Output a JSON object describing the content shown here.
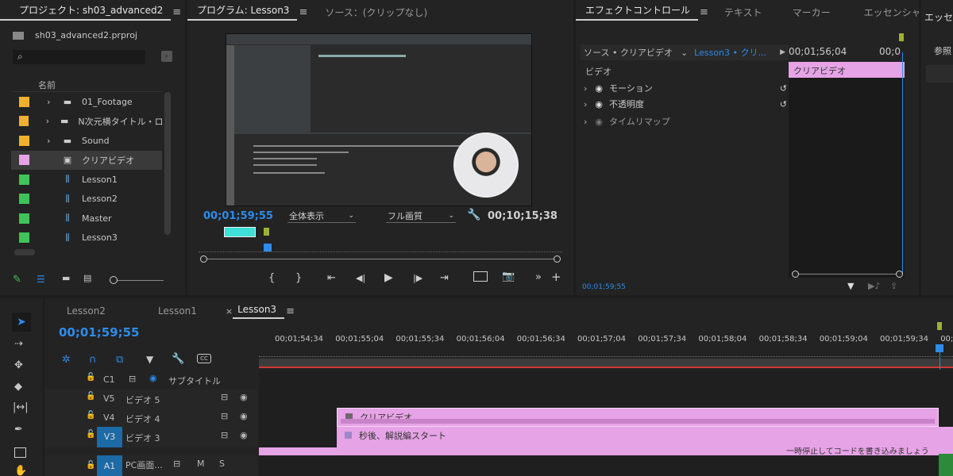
{
  "project": {
    "tab_title": "プロジェクト: sh03_advanced2",
    "file_name": "sh03_advanced2.prproj",
    "column_name": "名前",
    "items": [
      {
        "label": "01_Footage",
        "color": "#f2b02e",
        "type": "folder"
      },
      {
        "label": "N次元横タイトル・ロゴ",
        "color": "#f2b02e",
        "type": "folder"
      },
      {
        "label": "Sound",
        "color": "#f2b02e",
        "type": "folder"
      },
      {
        "label": "クリアビデオ",
        "color": "#e6a3e6",
        "type": "clip"
      },
      {
        "label": "Lesson1",
        "color": "#3ec45a",
        "type": "sequence"
      },
      {
        "label": "Lesson2",
        "color": "#3ec45a",
        "type": "sequence"
      },
      {
        "label": "Master",
        "color": "#3ec45a",
        "type": "sequence"
      },
      {
        "label": "Lesson3",
        "color": "#3ec45a",
        "type": "sequence"
      }
    ]
  },
  "program": {
    "tab_title": "プログラム: Lesson3",
    "source_tab": "ソース：(クリップなし)",
    "timecode_current": "00;01;59;55",
    "timecode_duration": "00;10;15;38",
    "zoom": "全体表示",
    "quality": "フル画質"
  },
  "effects": {
    "tabs": [
      "エフェクトコントロール",
      "テキスト",
      "マーカー",
      "エッセンシャ"
    ],
    "source_label": "ソース • クリアビデオ",
    "sequence_label": "Lesson3 • クリ...",
    "timecode_header": "00;01;56;04",
    "timecode_header2": "00;0",
    "section_video": "ビデオ",
    "items": [
      "モーション",
      "不透明度",
      "タイムリマップ"
    ],
    "clip_label": "クリアビデオ",
    "timecode_footer": "00;01;59;55"
  },
  "right_panel": {
    "tab": "エッセ",
    "label": "参照"
  },
  "timeline": {
    "tabs": [
      "Lesson2",
      "Lesson1",
      "Lesson3"
    ],
    "timecode": "00;01;59;55",
    "ruler": [
      "00;01;54;34",
      "00;01;55;04",
      "00;01;55;34",
      "00;01;56;04",
      "00;01;56;34",
      "00;01;57;04",
      "00;01;57;34",
      "00;01;58;04",
      "00;01;58;34",
      "00;01;59;04",
      "00;01;59;34",
      "00;0"
    ],
    "tracks": [
      {
        "id": "C1",
        "name": "サブタイトル"
      },
      {
        "id": "V5",
        "name": "ビデオ 5"
      },
      {
        "id": "V4",
        "name": "ビデオ 4"
      },
      {
        "id": "V3",
        "name": "ビデオ 3"
      },
      {
        "id": "A1",
        "name": "PC画面..."
      }
    ],
    "clip_v4": "クリアビデオ",
    "clip_v3": "秒後、解説編スタート",
    "clip_a1": "一時停止してコードを書き込みましょう",
    "a1_m": "M",
    "a1_s": "S"
  }
}
